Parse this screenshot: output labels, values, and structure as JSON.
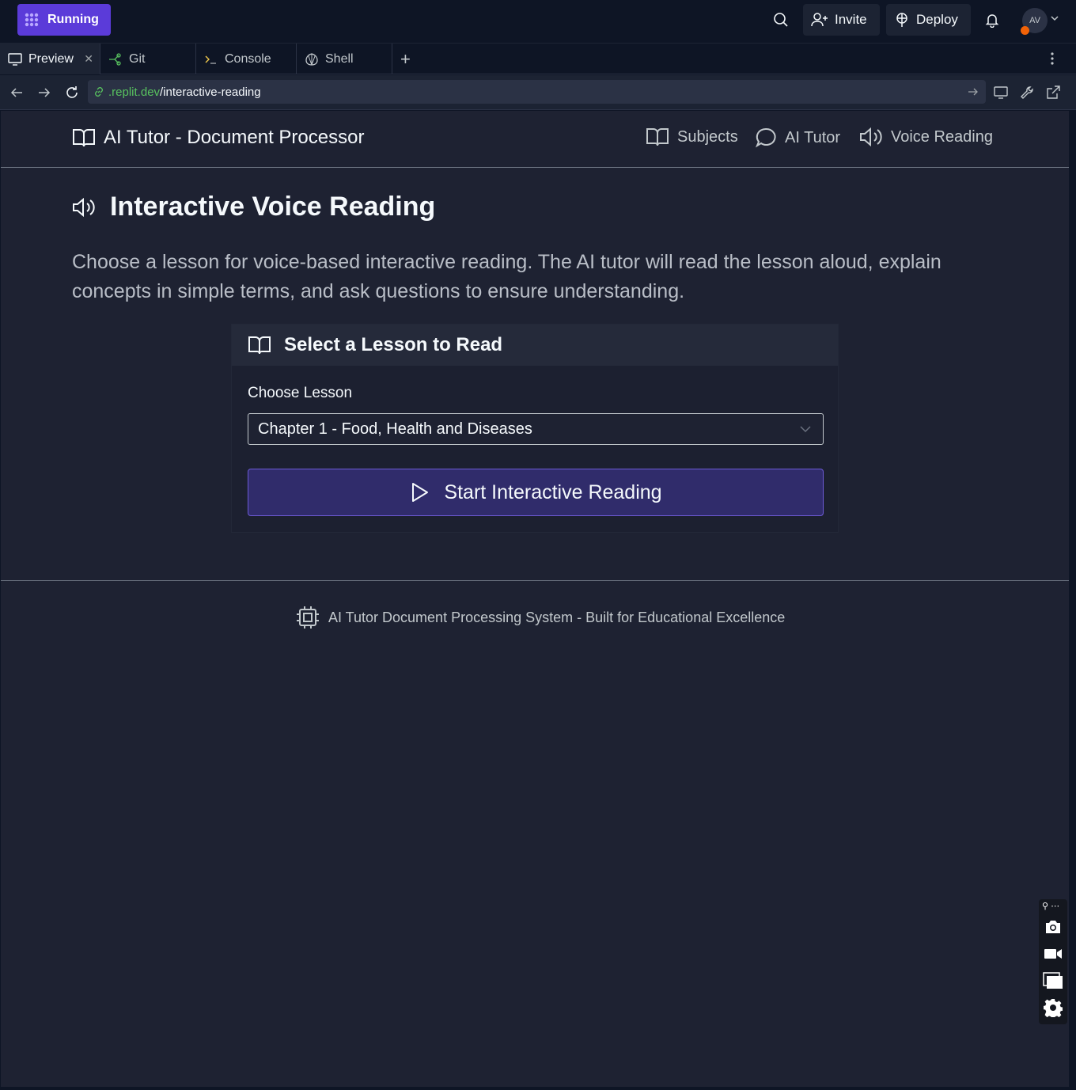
{
  "topbar": {
    "run_status": "Running",
    "invite_label": "Invite",
    "deploy_label": "Deploy",
    "avatar_initials": "AV"
  },
  "tabs": [
    {
      "label": "Preview",
      "icon": "monitor-icon"
    },
    {
      "label": "Git",
      "icon": "git-icon"
    },
    {
      "label": "Console",
      "icon": "terminal-icon"
    },
    {
      "label": "Shell",
      "icon": "shell-icon"
    }
  ],
  "urlbar": {
    "domain": ".replit.dev",
    "path": "/interactive-reading"
  },
  "app": {
    "brand": "AI Tutor - Document Processor",
    "nav": {
      "subjects": "Subjects",
      "ai_tutor": "AI Tutor",
      "voice_reading": "Voice Reading"
    },
    "page_title": "Interactive Voice Reading",
    "description": "Choose a lesson for voice-based interactive reading. The AI tutor will read the lesson aloud, explain concepts in simple terms, and ask questions to ensure understanding.",
    "card": {
      "title": "Select a Lesson to Read",
      "field_label": "Choose Lesson",
      "selected_lesson": "Chapter 1 - Food, Health and Diseases",
      "start_button": "Start Interactive Reading"
    },
    "footer": "AI Tutor Document Processing System - Built for Educational Excellence"
  },
  "colors": {
    "accent": "#5b3bd9",
    "button_bg": "#302c6b",
    "app_bg": "#1e2232",
    "chrome_bg": "#0e1525"
  }
}
